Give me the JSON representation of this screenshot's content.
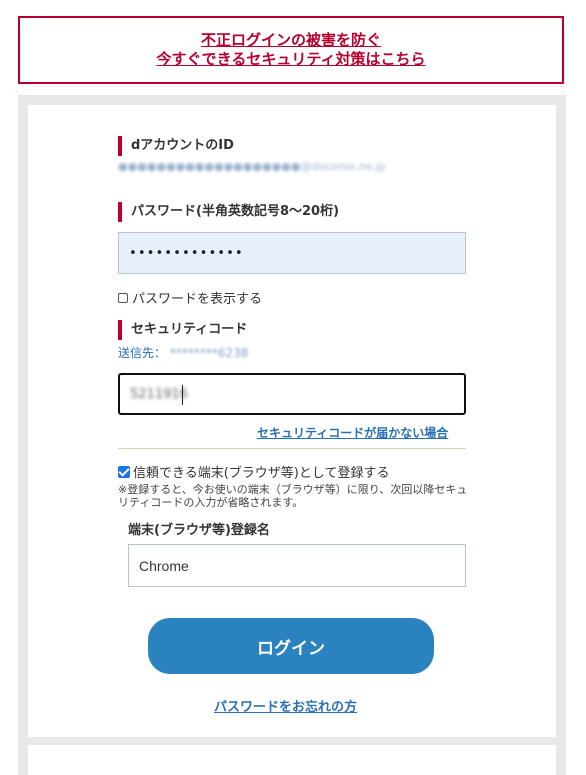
{
  "banner": {
    "line1": "不正ログインの被害を防ぐ",
    "line2": "今すぐできるセキュリティ対策はこちら"
  },
  "account": {
    "title": "dアカウントのID",
    "id_value": "●●●●●●●●●●●●●●●●●●●@docomo.ne.jp"
  },
  "password": {
    "title": "パスワード(半角英数記号8～20桁)",
    "value": "•••••••••••••",
    "show_label": "パスワードを表示する"
  },
  "security_code": {
    "title": "セキュリティコード",
    "send_to_label": "送信先：",
    "send_to_value": "********6238",
    "value": "5211916",
    "not_received_link": "セキュリティコードが届かない場合"
  },
  "trusted_device": {
    "checkbox_label": "信頼できる端末(ブラウザ等)として登録する",
    "checked": true,
    "note": "※登録すると、今お使いの端末（ブラウザ等）に限り、次回以降セキュリティコードの入力が省略されます。",
    "name_label": "端末(ブラウザ等)登録名",
    "name_value": "Chrome"
  },
  "actions": {
    "login_label": "ログイン",
    "forgot_password_link": "パスワードをお忘れの方"
  },
  "colors": {
    "accent_red": "#b8002e",
    "button_blue": "#2a82be",
    "link_blue": "#2a6fb5"
  }
}
